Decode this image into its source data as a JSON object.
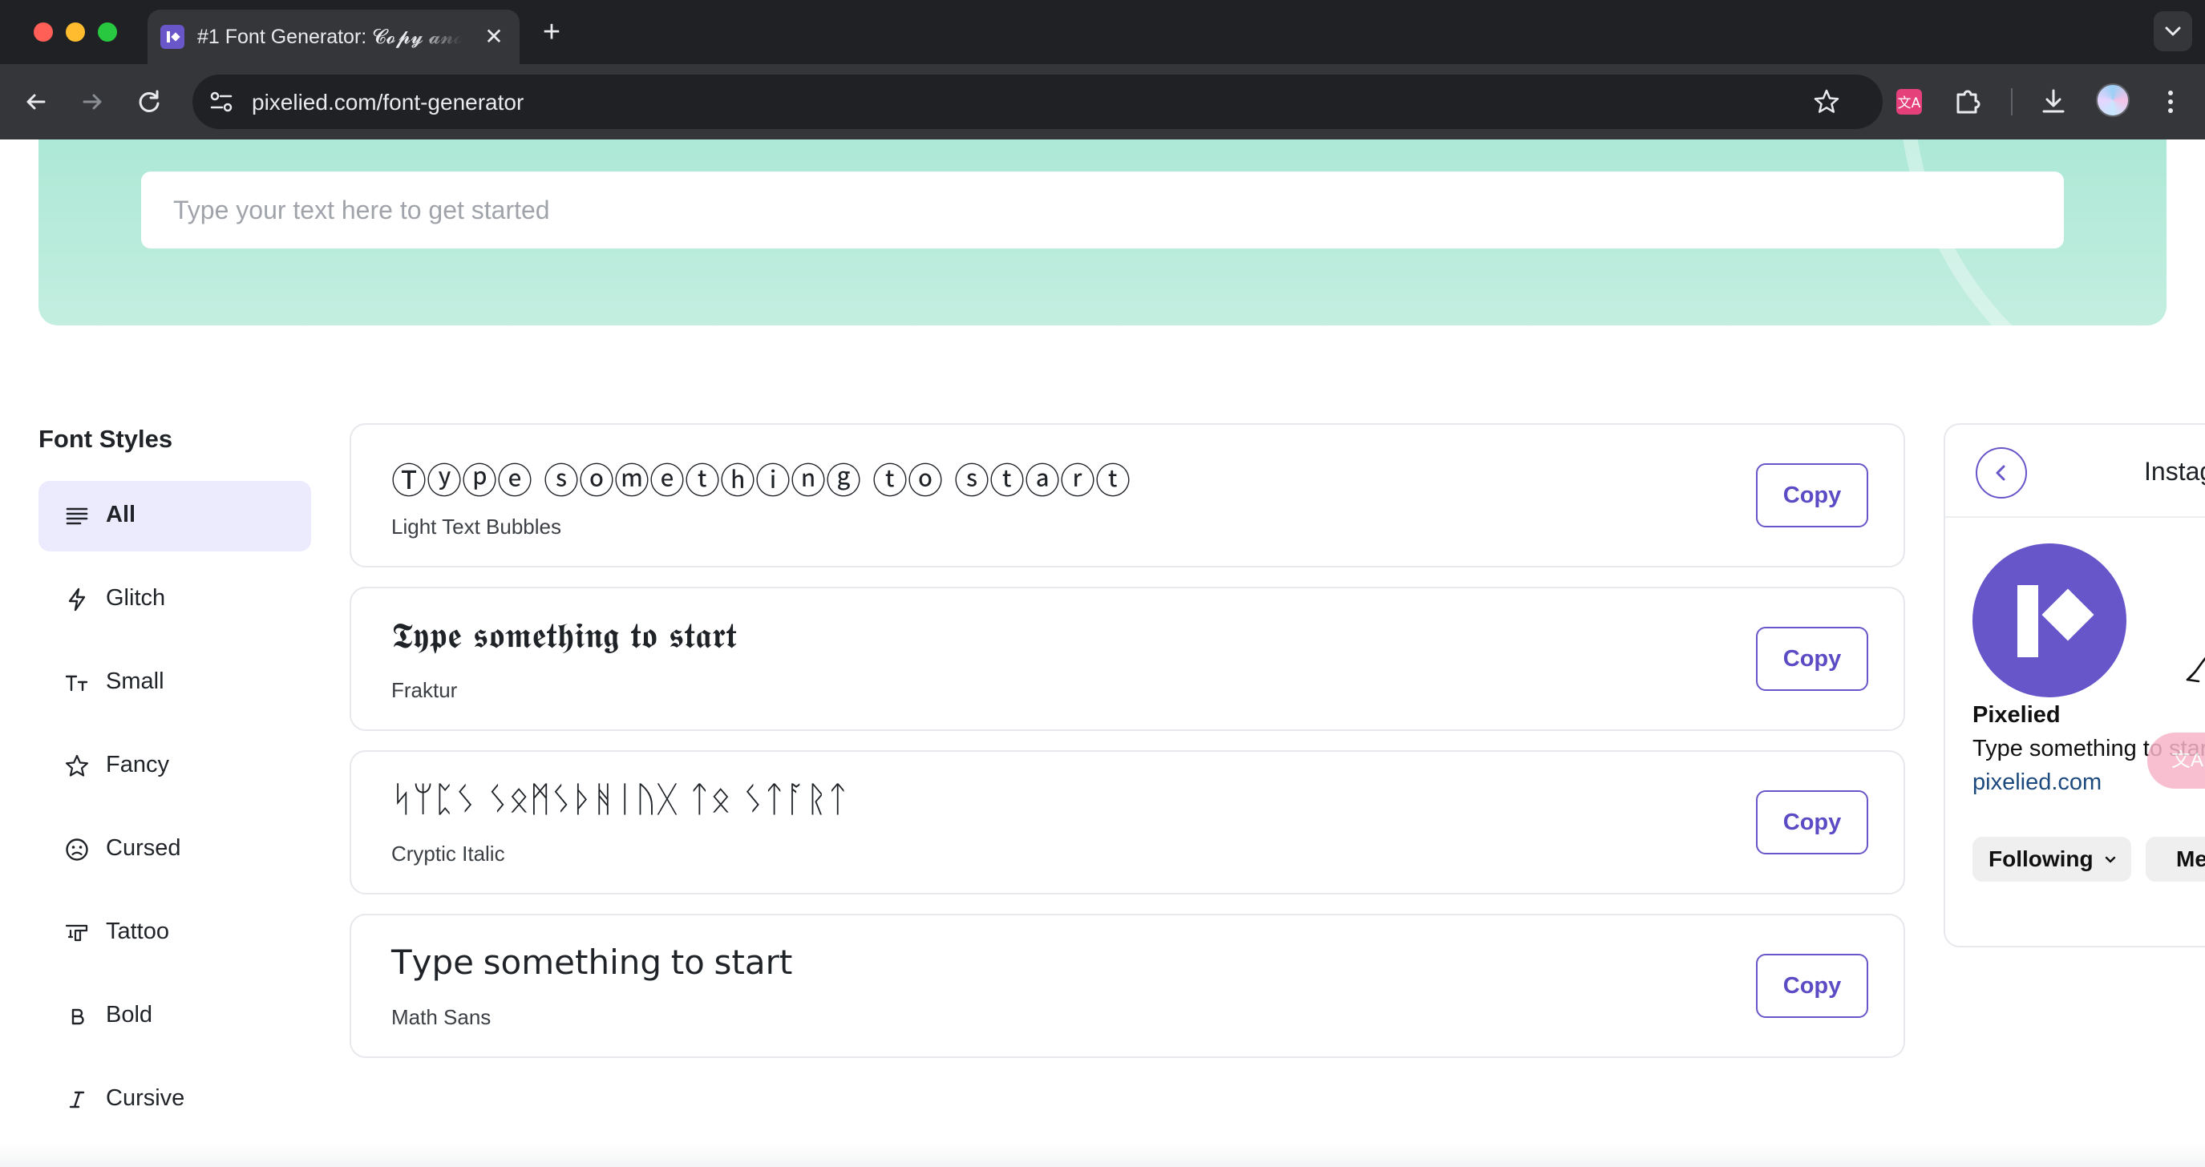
{
  "browser": {
    "tab_title": "#1 Font Generator: 𝓒𝓸𝓹𝔂 𝓪𝓷𝓭 𝓟𝓪𝓼𝓽𝓮",
    "tab_close": "✕",
    "new_tab": "+",
    "url": "pixelied.com/font-generator"
  },
  "hero": {
    "search_placeholder": "Type your text here to get started"
  },
  "sidebar": {
    "title": "Font Styles",
    "items": [
      {
        "label": "All",
        "icon": "lines-icon",
        "active": true
      },
      {
        "label": "Glitch",
        "icon": "lightning-icon"
      },
      {
        "label": "Small",
        "icon": "small-text-icon"
      },
      {
        "label": "Fancy",
        "icon": "star-icon"
      },
      {
        "label": "Cursed",
        "icon": "sad-face-icon"
      },
      {
        "label": "Tattoo",
        "icon": "tattoo-gun-icon"
      },
      {
        "label": "Bold",
        "icon": "bold-b-icon"
      },
      {
        "label": "Cursive",
        "icon": "italic-i-icon"
      }
    ]
  },
  "fonts": [
    {
      "sample": "Ⓣⓨⓟⓔ ⓢⓞⓜⓔⓣⓗⓘⓝⓖ ⓣⓞ ⓢⓣⓐⓡⓣ",
      "name": "Light Text Bubbles",
      "copy": "Copy"
    },
    {
      "sample": "𝕿𝖞𝖕𝖊 𝖘𝖔𝖒𝖊𝖙𝖍𝖎𝖓𝖌 𝖙𝖔 𝖘𝖙𝖆𝖗𝖙",
      "name": "Fraktur",
      "copy": "Copy"
    },
    {
      "sample": "ᛋᛘᛈᛊ ᛊᛟᛗᛊᚦᚻᛁᚢᚷ ᛏᛟ ᛊᛏᚪᚱᛏ",
      "name": "Cryptic Italic",
      "copy": "Copy"
    },
    {
      "sample": "𝖳𝗒𝗉𝖾 𝗌𝗈𝗆𝖾𝗍𝗁𝗂𝗇𝗀 𝗍𝗈 𝗌𝗍𝖺𝗋𝗍",
      "name": "Math Sans",
      "copy": "Copy"
    }
  ],
  "preview": {
    "title": "Instagram",
    "name": "Pixelied",
    "bio": "Type something to start",
    "link": "pixelied.com",
    "bubble": "文A",
    "following": "Following",
    "message": "Message"
  },
  "colors": {
    "accent": "#6656c9",
    "hero": "#b8ecdc",
    "chrome": "#202124"
  }
}
